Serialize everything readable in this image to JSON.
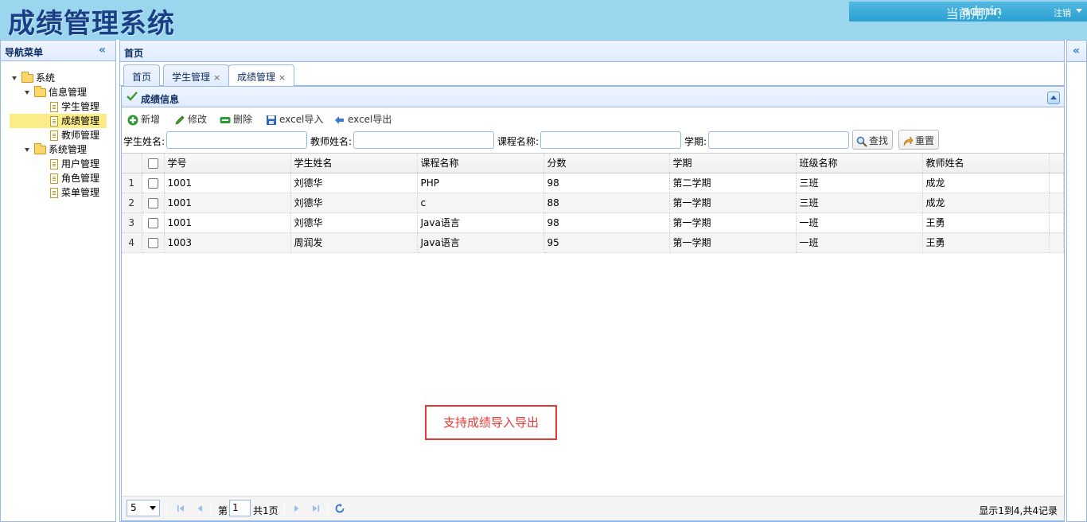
{
  "header": {
    "app_title": "成绩管理系统",
    "current_user_label": "当前用户:",
    "username": "admin",
    "logout_label": "注销"
  },
  "nav": {
    "title": "导航菜单",
    "tree": {
      "root": "系统",
      "group1": "信息管理",
      "group1_items": [
        "学生管理",
        "成绩管理",
        "教师管理"
      ],
      "group2": "系统管理",
      "group2_items": [
        "用户管理",
        "角色管理",
        "菜单管理"
      ],
      "selected": "成绩管理"
    }
  },
  "center": {
    "title": "首页",
    "tabs": [
      {
        "label": "首页",
        "closable": false
      },
      {
        "label": "学生管理",
        "closable": true
      },
      {
        "label": "成绩管理",
        "closable": true,
        "active": true
      }
    ],
    "close_glyph": "×"
  },
  "panel": {
    "title": "成绩信息",
    "toolbar": {
      "add": "新增",
      "edit": "修改",
      "delete": "删除",
      "import": "excel导入",
      "export": "excel导出"
    },
    "search": {
      "student_name_label": "学生姓名:",
      "teacher_name_label": "教师姓名:",
      "course_name_label": "课程名称:",
      "term_label": "学期:",
      "search_button": "查找",
      "reset_button": "重置"
    },
    "grid": {
      "columns": [
        "学号",
        "学生姓名",
        "课程名称",
        "分数",
        "学期",
        "班级名称",
        "教师姓名"
      ],
      "rows": [
        [
          "1001",
          "刘德华",
          "PHP",
          "98",
          "第二学期",
          "三班",
          "成龙"
        ],
        [
          "1001",
          "刘德华",
          "c",
          "88",
          "第一学期",
          "三班",
          "成龙"
        ],
        [
          "1001",
          "刘德华",
          "Java语言",
          "98",
          "第一学期",
          "一班",
          "王勇"
        ],
        [
          "1003",
          "周润发",
          "Java语言",
          "95",
          "第一学期",
          "一班",
          "王勇"
        ]
      ],
      "row_numbers": [
        "1",
        "2",
        "3",
        "4"
      ]
    },
    "annotation": "支持成绩导入导出",
    "pager": {
      "page_size": "5",
      "page_prefix": "第",
      "page_number": "1",
      "page_total": "共1页",
      "info": "显示1到4,共4记录"
    }
  },
  "colors": {
    "header_bg": "#9ad6ee",
    "title_color": "#1a3f86",
    "border": "#95b8e7",
    "selected_row": "#fbec88",
    "annotation_red": "#e53935"
  },
  "icons": [
    "folder-icon",
    "file-icon",
    "add-icon",
    "edit-icon",
    "delete-icon",
    "save-icon",
    "export-icon",
    "search-icon",
    "reset-icon",
    "refresh-icon",
    "check-icon"
  ]
}
